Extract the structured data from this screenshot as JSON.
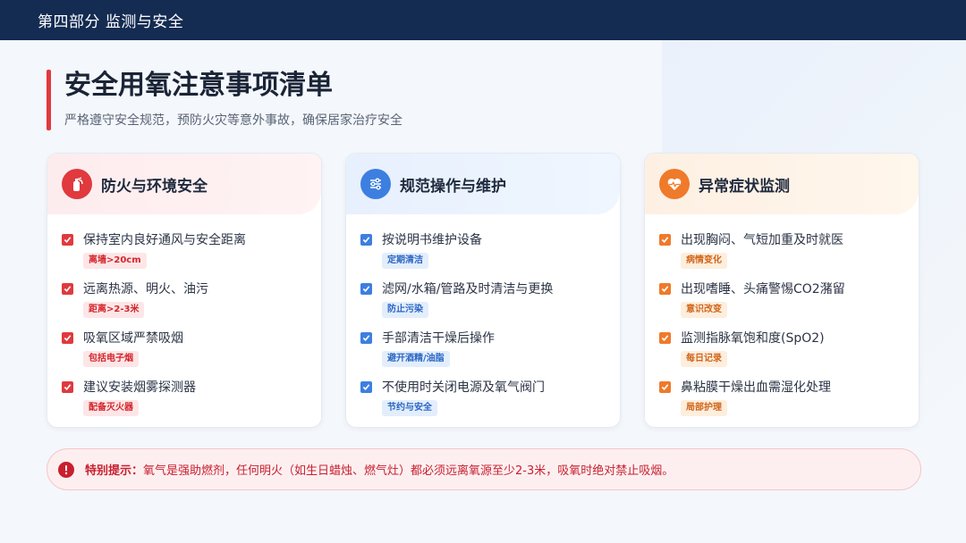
{
  "header": {
    "section": "第四部分 监测与安全"
  },
  "page": {
    "title": "安全用氧注意事项清单",
    "subtitle": "严格遵守安全规范，预防火灾等意外事故，确保居家治疗安全"
  },
  "cards": [
    {
      "title": "防火与环境安全",
      "icon": "fire-extinguisher-icon",
      "accent": "#e0393e",
      "items": [
        {
          "text": "保持室内良好通风与安全距离",
          "tag": "离墙>20cm"
        },
        {
          "text": "远离热源、明火、油污",
          "tag": "距离>2-3米"
        },
        {
          "text": "吸氧区域严禁吸烟",
          "tag": "包括电子烟"
        },
        {
          "text": "建议安装烟雾探测器",
          "tag": "配备灭火器"
        }
      ]
    },
    {
      "title": "规范操作与维护",
      "icon": "sliders-icon",
      "accent": "#3d7fe0",
      "items": [
        {
          "text": "按说明书维护设备",
          "tag": "定期清洁"
        },
        {
          "text": "滤网/水箱/管路及时清洁与更换",
          "tag": "防止污染"
        },
        {
          "text": "手部清洁干燥后操作",
          "tag": "避开酒精/油脂"
        },
        {
          "text": "不使用时关闭电源及氧气阀门",
          "tag": "节约与安全"
        }
      ]
    },
    {
      "title": "异常症状监测",
      "icon": "heart-pulse-icon",
      "accent": "#ef7a2a",
      "items": [
        {
          "text": "出现胸闷、气短加重及时就医",
          "tag": "病情变化"
        },
        {
          "text": "出现嗜睡、头痛警惕CO2潴留",
          "tag": "意识改变"
        },
        {
          "text": "监测指脉氧饱和度(SpO2)",
          "tag": "每日记录"
        },
        {
          "text": "鼻粘膜干燥出血需湿化处理",
          "tag": "局部护理"
        }
      ]
    }
  ],
  "notice": {
    "label": "特别提示：",
    "text": "氧气是强助燃剂，任何明火（如生日蜡烛、燃气灶）都必须远离氧源至少2-3米，吸氧时绝对禁止吸烟。",
    "icon": "exclamation-icon",
    "color": "#c8202f"
  }
}
